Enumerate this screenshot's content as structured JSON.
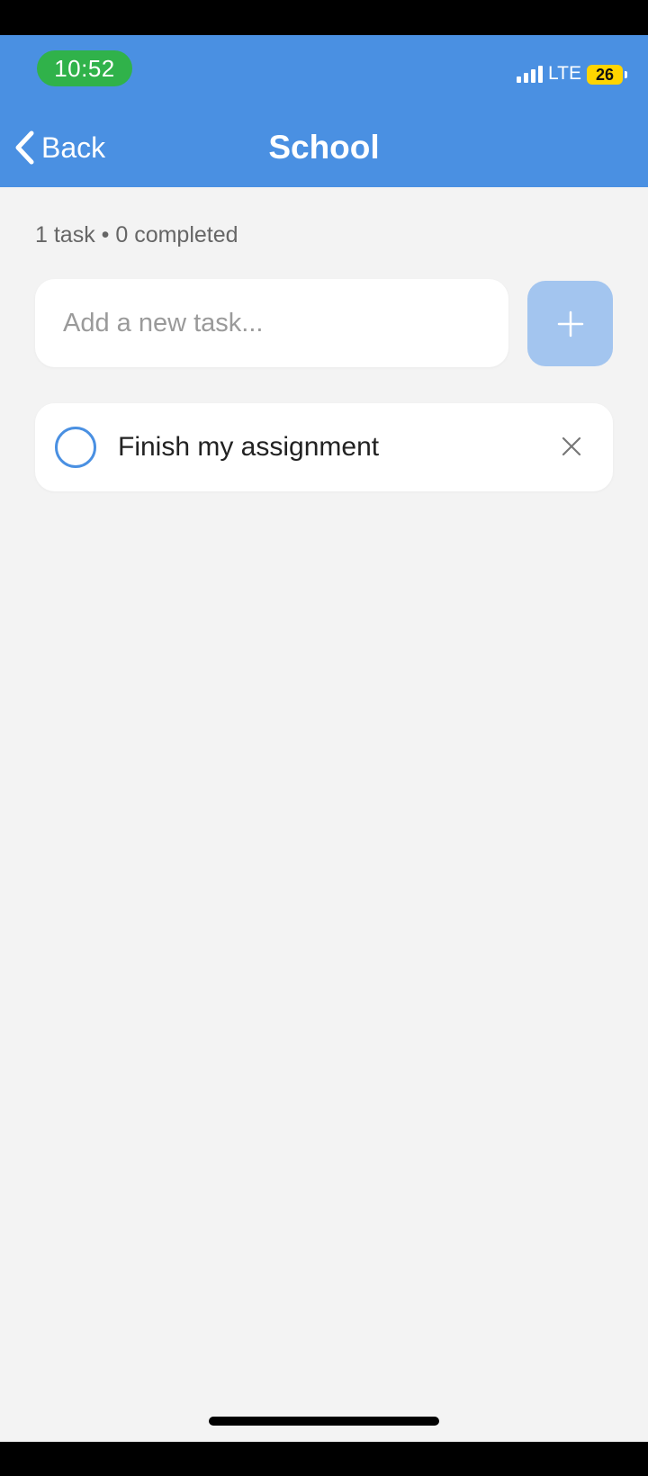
{
  "status_bar": {
    "time": "10:52",
    "network": "LTE",
    "battery": "26"
  },
  "header": {
    "back_label": "Back",
    "title": "School"
  },
  "summary": "1 task • 0 completed",
  "new_task": {
    "placeholder": "Add a new task...",
    "value": ""
  },
  "tasks": [
    {
      "text": "Finish my assignment",
      "completed": false
    }
  ],
  "colors": {
    "header": "#4a90e2",
    "add_button": "#a3c5ef",
    "time_pill": "#30b24a",
    "battery": "#ffd400",
    "background": "#f3f3f3"
  },
  "icons": {
    "back": "chevron-left-icon",
    "add": "plus-icon",
    "check": "circle-outline-icon",
    "delete": "close-icon"
  }
}
